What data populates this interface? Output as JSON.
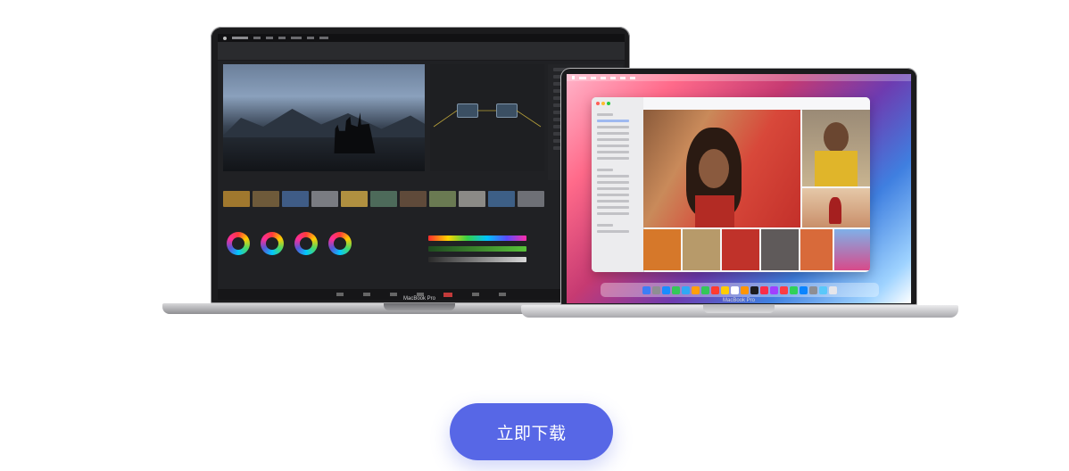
{
  "hero": {
    "left_laptop_model": "MacBook Pro",
    "right_laptop_model": "MacBook Pro"
  },
  "cta": {
    "download_label": "立即下载",
    "accent_color": "#5767e6"
  },
  "icons": [
    "laptop-image-icon",
    "laptop-image-icon"
  ]
}
